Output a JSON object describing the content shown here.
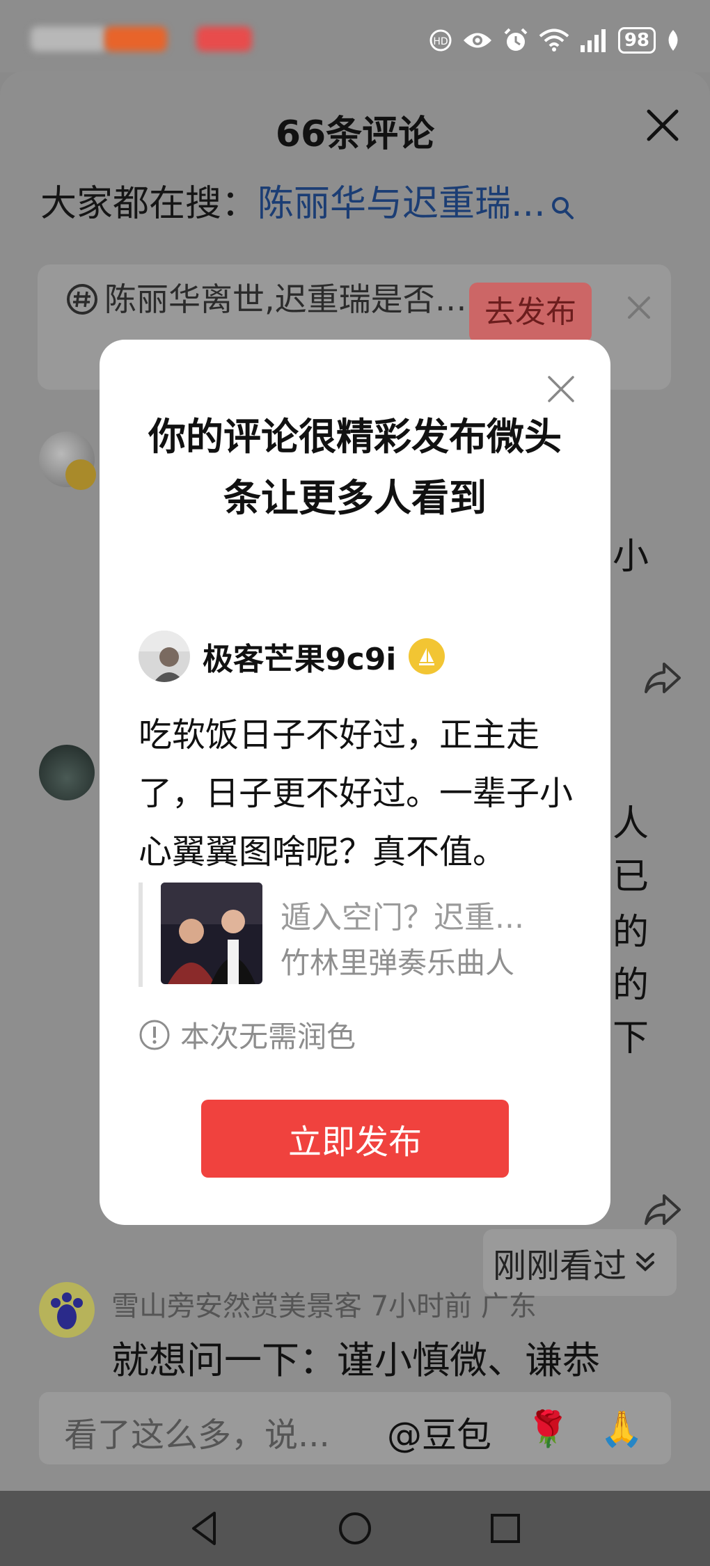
{
  "status_bar": {
    "battery": "98",
    "icons": [
      "hd-icon",
      "eye-icon",
      "alarm-icon",
      "wifi-icon",
      "signal-icon",
      "battery-icon",
      "leaf-icon"
    ]
  },
  "sheet": {
    "title": "66条评论",
    "search_label": "大家都在搜：",
    "search_term": "陈丽华与迟重瑞...",
    "topic_text": "陈丽华离世,迟重瑞是否…",
    "topic_button": "去发布",
    "bg_comments": [
      {
        "right_text": "小"
      },
      {
        "right_lines": [
          "人",
          "已",
          "的",
          "的",
          "下"
        ]
      }
    ],
    "recent_label": "刚刚看过",
    "last_comment_meta": "雪山旁安然赏美景客 7小时前 广东",
    "last_comment_text": "就想问一下：谨小慎微、谦恭"
  },
  "input_bar": {
    "placeholder": "看了这么多，说...",
    "doubao": "@豆包",
    "emojis": [
      "🌹",
      "🙏"
    ]
  },
  "modal": {
    "title": "你的评论很精彩发布微头条让更多人看到",
    "author_name": "极客芒果9c9i",
    "comment": "吃软饭日子不好过，正主走了，日子更不好过。一辈子小心翼翼图啥呢？真不值。",
    "quote_title": "遁入空门？迟重...",
    "quote_author": "竹林里弹奏乐曲人",
    "hint": "本次无需润色",
    "publish_button": "立即发布"
  },
  "colors": {
    "accent_red": "#f0423e",
    "link_blue": "#1b3d74",
    "overlay_gray": "#8e8e8e",
    "badge_gold": "#f2c533"
  }
}
